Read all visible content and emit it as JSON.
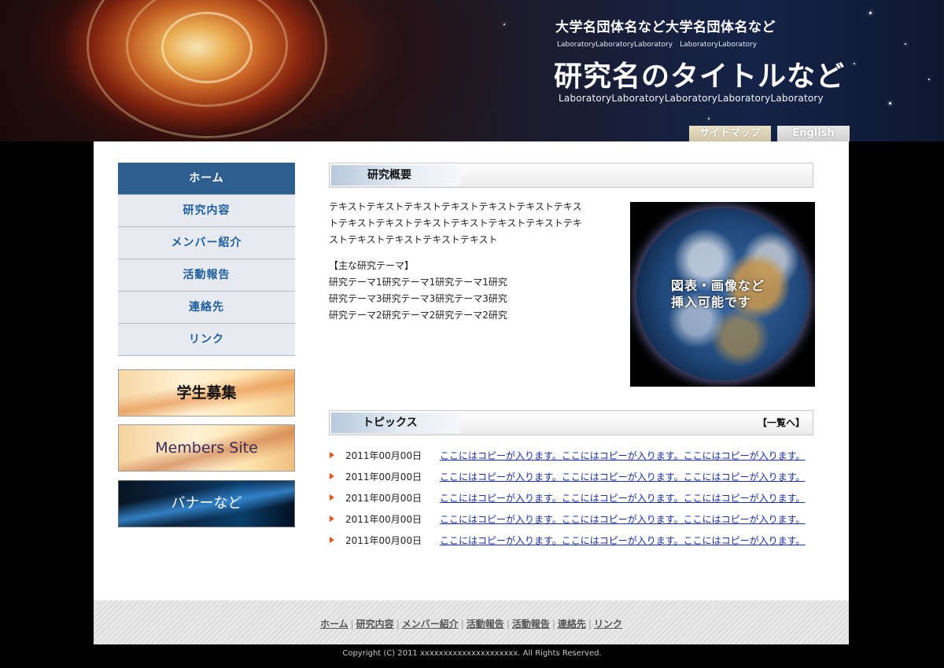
{
  "header": {
    "org_name": "大学名団体名など大学名団体名など",
    "org_sub": "LaboratoryLaboratoryLaboratory　LaboratoryLaboratory",
    "lab_title": "研究名のタイトルなど",
    "lab_sub": "LaboratoryLaboratoryLaboratoryLaboratoryLaboratory",
    "sitemap_label": "サイトマップ",
    "english_label": "English"
  },
  "nav": {
    "items": [
      {
        "label": "ホーム"
      },
      {
        "label": "研究内容"
      },
      {
        "label": "メンバー紹介"
      },
      {
        "label": "活動報告"
      },
      {
        "label": "連絡先"
      },
      {
        "label": "リンク"
      }
    ]
  },
  "banners": {
    "recruit": "学生募集",
    "members": "Members Site",
    "other": "バナーなど"
  },
  "overview": {
    "heading": "研究概要",
    "text1": "テキストテキストテキストテキストテキストテキストテキストテキストテキストテキストテキストテキストテキストテキストテキストテキストテキストテキスト",
    "themes_title": "【主な研究テーマ】",
    "theme1": "研究テーマ1研究テーマ1研究テーマ1研究",
    "theme2": "研究テーマ3研究テーマ3研究テーマ3研究",
    "theme3": "研究テーマ2研究テーマ2研究テーマ2研究",
    "image_caption_1": "図表・画像など",
    "image_caption_2": "挿入可能です"
  },
  "topics": {
    "heading": "トピックス",
    "more_label": "【一覧へ】",
    "items": [
      {
        "date": "2011年00月00日",
        "text": "ここにはコピーが入ります。ここにはコピーが入ります。ここにはコピーが入ります。"
      },
      {
        "date": "2011年00月00日",
        "text": "ここにはコピーが入ります。ここにはコピーが入ります。ここにはコピーが入ります。"
      },
      {
        "date": "2011年00月00日",
        "text": "ここにはコピーが入ります。ここにはコピーが入ります。ここにはコピーが入ります。"
      },
      {
        "date": "2011年00月00日",
        "text": "ここにはコピーが入ります。ここにはコピーが入ります。ここにはコピーが入ります。"
      },
      {
        "date": "2011年00月00日",
        "text": "ここにはコピーが入ります。ここにはコピーが入ります。ここにはコピーが入ります。"
      }
    ]
  },
  "footer": {
    "links": [
      "ホーム",
      "研究内容",
      "メンバー紹介",
      "活動報告",
      "活動報告",
      "連絡先",
      "リンク"
    ],
    "copyright": "Copyright (C) 2011 xxxxxxxxxxxxxxxxxxxxx. All Rights Reserved."
  },
  "colors": {
    "nav_active": "#2e5e90",
    "nav_text": "#1d5ea0",
    "link": "#1a2fa8",
    "bullet": "#e8541c"
  }
}
